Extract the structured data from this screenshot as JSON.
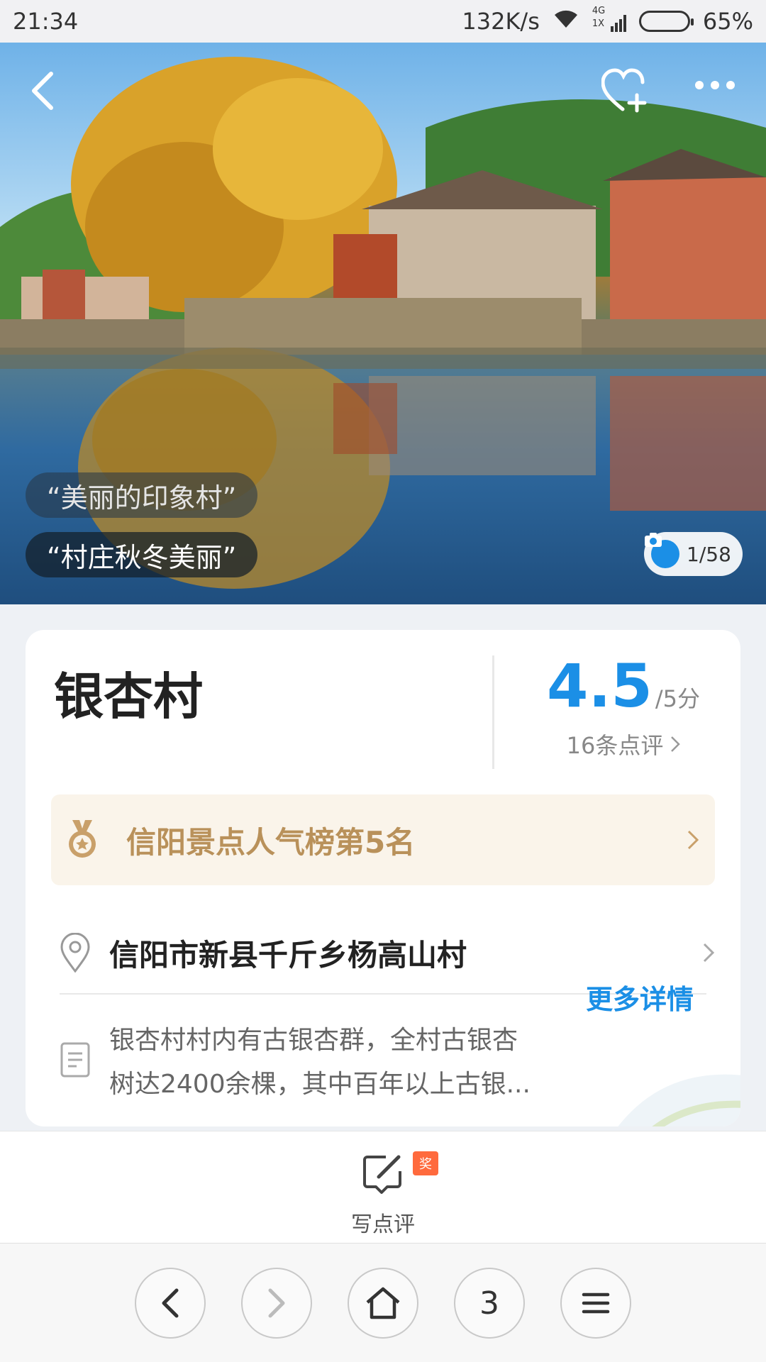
{
  "status_bar": {
    "time": "21:34",
    "net_speed": "132K/s",
    "network_type": "4G",
    "network_sub": "1X",
    "battery": "65%",
    "icons": [
      "wifi-icon",
      "signal-icon",
      "battery-icon"
    ]
  },
  "hero": {
    "tags": [
      "“美丽的印象村”",
      "“村庄秋冬美丽”"
    ],
    "photo_counter": "1/58",
    "icons": [
      "back-icon",
      "favorite-add-icon",
      "more-icon",
      "camera-icon"
    ]
  },
  "poi": {
    "name": "银杏村",
    "score": "4.5",
    "score_max": "/5分",
    "review_count": "16条点评",
    "rank_label": "信阳景点人气榜第5名",
    "address": "信阳市新县千斤乡杨高山村",
    "description_line1": "银杏村村内有古银杏群，全村古银杏",
    "description_line2": "树达2400余棵，其中百年以上古银...",
    "more_link": "更多详情"
  },
  "review_bar": {
    "write_label": "写点评",
    "award_badge": "奖"
  },
  "browser_nav": {
    "tab_count": "3",
    "icons": [
      "back-icon",
      "forward-icon",
      "home-icon",
      "tabs-icon",
      "menu-icon"
    ]
  },
  "colors": {
    "accent_blue": "#1b8fe6",
    "rank_gold": "#b9915a",
    "rank_bg": "#faf4ea",
    "badge_orange": "#ff6a3d"
  }
}
